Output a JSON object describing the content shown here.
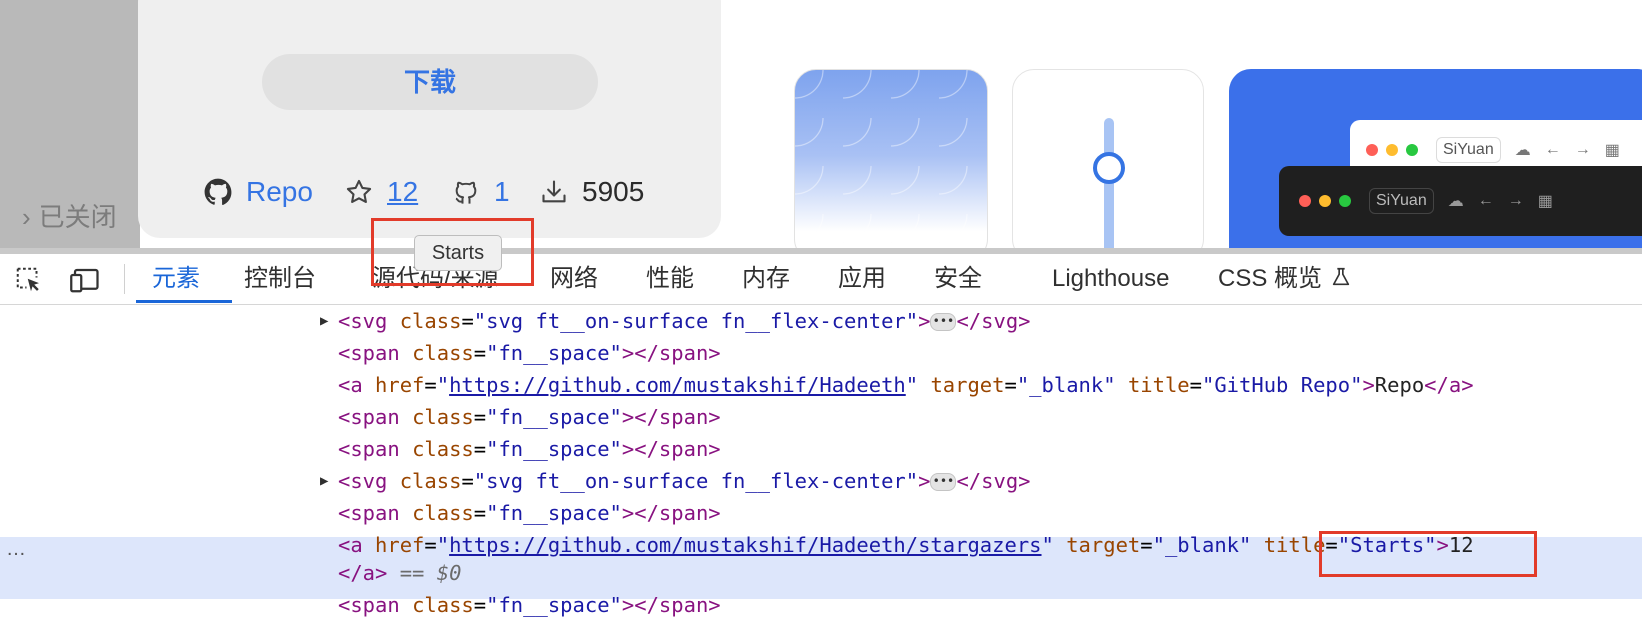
{
  "page": {
    "download_label": "下载",
    "closed_label": "已关闭",
    "stats": {
      "repo_label": "Repo",
      "stars_count": "12",
      "forks_count": "1",
      "downloads_count": "5905"
    },
    "mini_window_label": "SiYuan",
    "accent_color": "#3574e3"
  },
  "tooltip": {
    "text": "Starts"
  },
  "devtools": {
    "tabs": [
      "元素",
      "控制台",
      "源代码/来源",
      "网络",
      "性能",
      "内存",
      "应用",
      "安全",
      "Lighthouse",
      "CSS 概览"
    ],
    "active_tab": "元素",
    "code": {
      "svg_open": "<svg",
      "class_attr": "class",
      "svg_class_value": "\"svg ft__on-surface fn__flex-center\"",
      "svg_close": "</svg>",
      "span_open": "<span",
      "space_class_value": "\"fn__space\"",
      "span_close": "></span>",
      "a_open": "<a",
      "href_attr": "href",
      "target_attr": "target",
      "title_attr": "title",
      "target_value": "\"_blank\"",
      "repo_url": "https://github.com/mustakshif/Hadeeth",
      "repo_title_value": "\"GitHub Repo\"",
      "repo_text": "Repo",
      "a_close": "</a>",
      "stars_url": "https://github.com/mustakshif/Hadeeth/stargazers",
      "stars_title_value": "\"Starts\"",
      "stars_text": "12",
      "dollar_zero": "== $0",
      "ellipsis": "•••",
      "row_dots": "…"
    }
  }
}
